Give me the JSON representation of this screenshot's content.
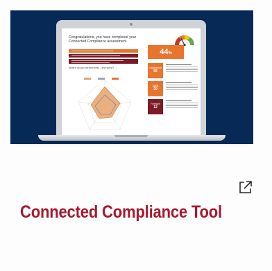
{
  "card": {
    "title": "Connected Compliance Tool",
    "title_color": "#a6192e",
    "external_link_icon": "external-link-icon"
  },
  "hero": {
    "background_color": "#062a55",
    "screen": {
      "heading": "Congratulations, you have completed your Connected Compliance assessment.",
      "subheading": "Where do you perform best – and worst?",
      "score": "44",
      "score_suffix": "%",
      "categories": [
        {
          "label": "Collaboration",
          "value": "58",
          "color": "#e8752e"
        },
        {
          "label": "Agility",
          "value": "29",
          "color": "#e8752e"
        },
        {
          "label": "Foresight",
          "value": "12",
          "color": "#7a1b27"
        }
      ],
      "accent_orange": "#e8752e",
      "accent_maroon": "#7a1b27"
    }
  }
}
